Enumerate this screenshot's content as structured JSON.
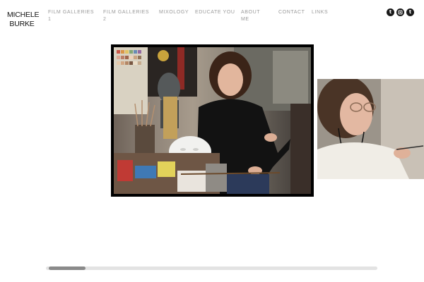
{
  "logo": {
    "line1": "MICHELE",
    "line2": "BURKE"
  },
  "nav": {
    "items": [
      {
        "line1": "FILM GALLERIES",
        "line2": "1"
      },
      {
        "line1": "FILM GALLERIES",
        "line2": "2"
      },
      {
        "line1": "MIXOLOGY",
        "line2": ""
      },
      {
        "line1": "EDUCATE YOU",
        "line2": ""
      },
      {
        "line1": "ABOUT",
        "line2": "ME"
      },
      {
        "line1": "CONTACT",
        "line2": ""
      },
      {
        "line1": "LINKS",
        "line2": ""
      }
    ]
  },
  "social": {
    "icons": [
      {
        "name": "twitter-icon",
        "glyph": "t"
      },
      {
        "name": "instagram-icon",
        "glyph": "o"
      },
      {
        "name": "tumblr-icon",
        "glyph": "t"
      }
    ]
  },
  "gallery": {
    "images": [
      {
        "name": "main-photo"
      },
      {
        "name": "side-photo"
      }
    ],
    "scroll_position": 0.1
  },
  "colors": {
    "nav_text": "#9a9a9a",
    "frame": "#000000",
    "scroll_track": "#e3e3e3",
    "scroll_thumb": "#8a8a8a"
  }
}
